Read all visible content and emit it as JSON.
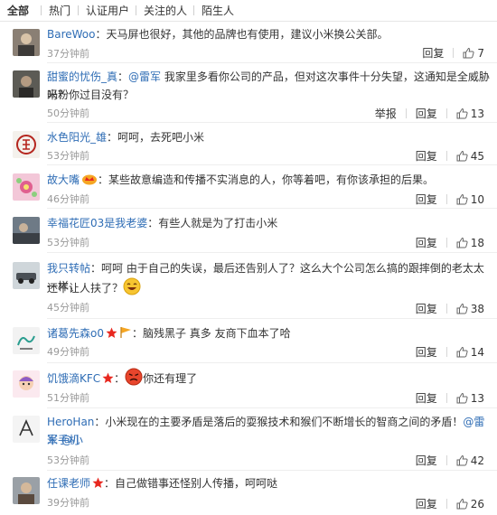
{
  "filters": {
    "tabs": [
      "全部",
      "热门",
      "认证用户",
      "关注的人",
      "陌生人"
    ]
  },
  "actions": {
    "reply": "回复",
    "report": "举报"
  },
  "colors": {
    "link": "#2f6db5",
    "time": "#999999",
    "text": "#333333",
    "badge_red": "#e8281f",
    "badge_gold": "#f5a623"
  },
  "comments": [
    {
      "user": "BareWoo",
      "text": "：天马屏也很好，其他的品牌也有使用，建议小米换公关部。",
      "time": "37分钟前",
      "likes": "7",
      "avatar_icon": "photo-avatar-icon"
    },
    {
      "user": "甜蜜的忧伤_真",
      "mention": "@雷军",
      "text_a": "：",
      "text_b": " 我家里多看你公司的产品，但对这次事件十分失望，这通知是全威胁米粉",
      "text_line2": "吗？你过目没有？",
      "time": "50分钟前",
      "likes": "13",
      "avatar_icon": "photo-avatar-icon"
    },
    {
      "user": "水色阳光_雄",
      "text": "：呵呵，去死吧小米",
      "time": "53分钟前",
      "likes": "45",
      "avatar_icon": "logo-avatar-icon"
    },
    {
      "user": "故大嘴",
      "text": "：某些故意编造和传播不实消息的人，你等着吧，有你该承担的后果。",
      "time": "46分钟前",
      "likes": "10",
      "avatar_icon": "flower-avatar-icon"
    },
    {
      "user": "幸福花匠03是我老婆",
      "text": "：有些人就是为了打击小米",
      "time": "53分钟前",
      "likes": "18",
      "avatar_icon": "photo-avatar-icon"
    },
    {
      "user": "我只转帖",
      "text": "：呵呵 由于自己的失误，最后还告别人了？这么大个公司怎么搞的跟摔倒的老太太一样，",
      "text_line2": "还不让人扶了？",
      "time": "45分钟前",
      "likes": "38",
      "avatar_icon": "car-avatar-icon"
    },
    {
      "user": "诸葛先森o0",
      "text": "：脑残黑子 真多 友商下血本了哈",
      "time": "49分钟前",
      "likes": "14",
      "avatar_icon": "sketch-avatar-icon"
    },
    {
      "user": "饥饿滴KFC",
      "text": "你还有理了",
      "time": "51分钟前",
      "likes": "13",
      "avatar_icon": "cartoon-avatar-icon"
    },
    {
      "user": "HeroHan",
      "text": "：小米现在的主要矛盾是落后的耍猴技术和猴们不断增长的智商之间的矛盾！",
      "mention1": "@雷军",
      "mention2": "@小",
      "mention2_line2": "米手机",
      "time": "53分钟前",
      "likes": "42",
      "avatar_icon": "sketch-avatar-icon"
    },
    {
      "user": "任课老师",
      "text": "：自己做错事还怪别人传播，呵呵哒",
      "time": "39分钟前",
      "likes": "26",
      "avatar_icon": "photo-avatar-icon"
    }
  ]
}
